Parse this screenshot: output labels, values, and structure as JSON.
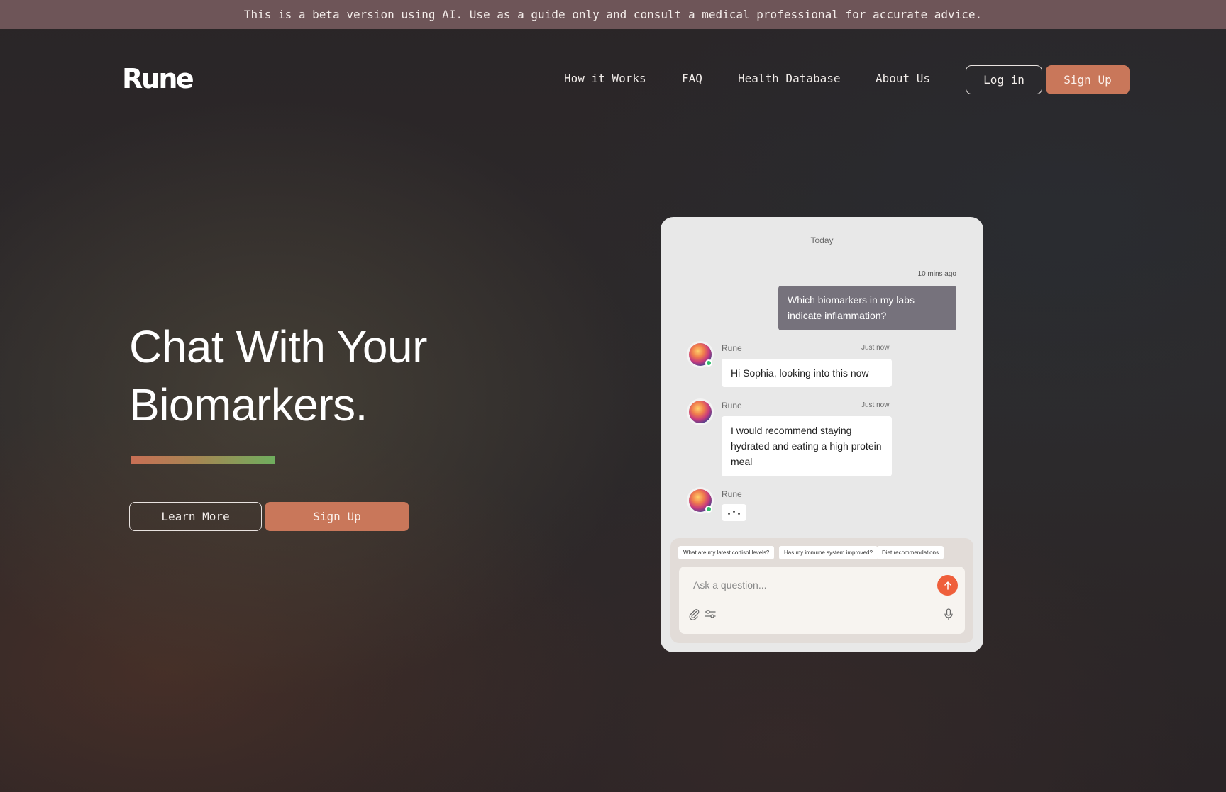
{
  "banner": {
    "text": "This is a beta version using AI. Use as a guide only and consult a medical professional for accurate advice."
  },
  "header": {
    "logo": "Rune",
    "nav": [
      {
        "label": "How it Works"
      },
      {
        "label": "FAQ"
      },
      {
        "label": "Health Database"
      },
      {
        "label": "About Us"
      }
    ],
    "login_label": "Log in",
    "signup_label": "Sign Up"
  },
  "hero": {
    "title_line1": "Chat With Your",
    "title_line2": "Biomarkers.",
    "learn_more_label": "Learn More",
    "signup_label": "Sign Up"
  },
  "chat": {
    "day_label": "Today",
    "user_message": {
      "time": "10 mins ago",
      "text": "Which biomarkers in my labs indicate inflammation?"
    },
    "bot_messages": [
      {
        "sender": "Rune",
        "time": "Just now",
        "text": "Hi Sophia, looking into this now"
      },
      {
        "sender": "Rune",
        "time": "Just now",
        "text": "I would recommend staying hydrated and eating a high protein meal"
      },
      {
        "sender": "Rune"
      }
    ],
    "suggestions": [
      "What are my latest cortisol levels?",
      "Has my immune system improved?",
      "Diet recommendations"
    ],
    "input_placeholder": "Ask a question...",
    "icons": {
      "send": "arrow-up-icon",
      "attach": "paperclip-icon",
      "settings": "sliders-icon",
      "voice": "microphone-icon"
    }
  },
  "colors": {
    "accent": "#c9775a",
    "banner": "#6e5558",
    "send": "#ef5f3b",
    "online": "#2ebc6b"
  }
}
